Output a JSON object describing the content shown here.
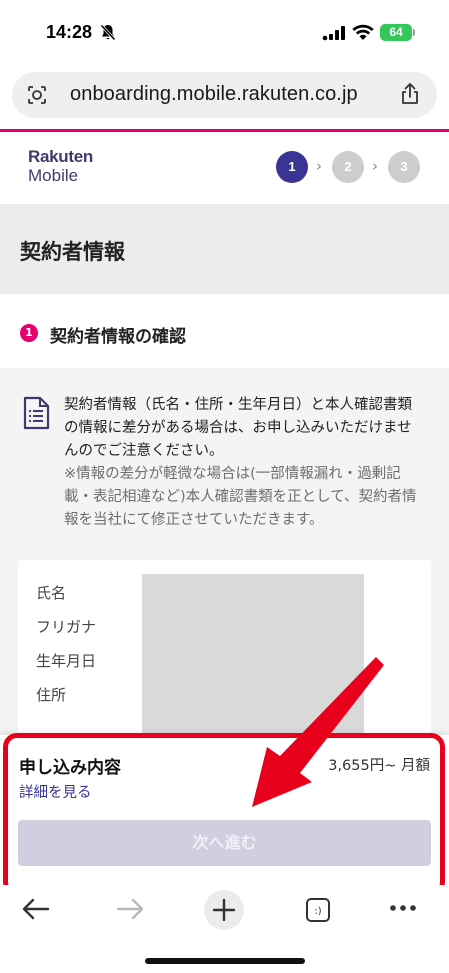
{
  "status_bar": {
    "time": "14:28",
    "battery": "64"
  },
  "browser": {
    "url": "onboarding.mobile.rakuten.co.jp"
  },
  "header": {
    "logo_line1": "Rakuten",
    "logo_line2": "Mobile",
    "steps": [
      "1",
      "2",
      "3"
    ],
    "active_step": "1"
  },
  "page": {
    "title": "契約者情報"
  },
  "section": {
    "number": "1",
    "title": "契約者情報の確認"
  },
  "notice": {
    "main": "契約者情報（氏名・住所・生年月日）と本人確認書類の情報に差分がある場合は、お申し込みいただけませんのでご注意ください。",
    "sub": "※情報の差分が軽微な場合は(一部情報漏れ・過剰記載・表記相違など)本人確認書類を正として、契約者情報を当社にて修正させていただきます。"
  },
  "info": {
    "labels": [
      "氏名",
      "フリガナ",
      "生年月日",
      "住所"
    ]
  },
  "summary": {
    "title": "申し込み内容",
    "price": "3,655円~ 月額",
    "details_link": "詳細を見る",
    "next_button": "次へ進む"
  },
  "colors": {
    "brand_pink": "#e5006e",
    "brand_purple": "#3a3494",
    "annotation_red": "#e8001c",
    "button_disabled": "#cfcfdf"
  }
}
